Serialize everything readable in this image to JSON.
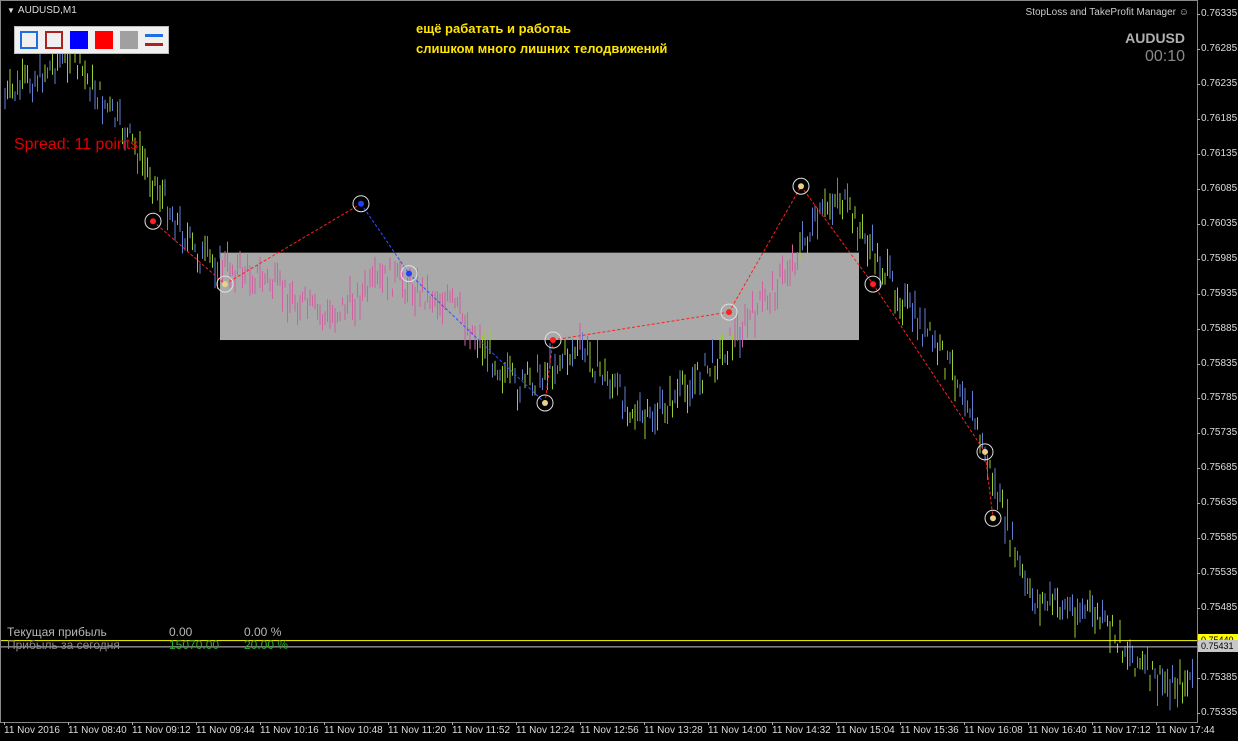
{
  "window": {
    "symbol_timeframe": "AUDUSD,M1",
    "indicator_name": "StopLoss and TakeProfit Manager ☺"
  },
  "color_panel": {
    "buttons": [
      {
        "name": "outline-blue",
        "fill": "#f0f0f0",
        "border": "#1f6fe0"
      },
      {
        "name": "outline-red",
        "fill": "#f0f0f0",
        "border": "#b02020"
      },
      {
        "name": "solid-blue",
        "fill": "#0000ff",
        "border": "#0000ff"
      },
      {
        "name": "solid-red",
        "fill": "#ff0000",
        "border": "#ff0000"
      },
      {
        "name": "solid-gray",
        "fill": "#a0a0a0",
        "border": "#a0a0a0"
      },
      {
        "name": "lines-blue-red",
        "fill": "",
        "border": ""
      }
    ]
  },
  "annotations": {
    "line1": "ещё  рабатать и работаь",
    "line2": "слишком много лишних телодвижений",
    "spread": "Spread: 11 points"
  },
  "symbol_box": {
    "symbol": "AUDUSD",
    "timer": "00:10"
  },
  "profit_panel": {
    "current_label": "Текущая прибыль",
    "current_value": "0.00",
    "current_percent": "0.00 %",
    "today_label": "Прибыль за сегодня",
    "today_value": "15070.00",
    "today_percent": "20.00 %"
  },
  "price_axis": {
    "ticks": [
      "0.76335",
      "0.76285",
      "0.76235",
      "0.76185",
      "0.76135",
      "0.76085",
      "0.76035",
      "0.75985",
      "0.75935",
      "0.75885",
      "0.75835",
      "0.75785",
      "0.75735",
      "0.75685",
      "0.75635",
      "0.75585",
      "0.75535",
      "0.75485",
      "0.75435",
      "0.75385",
      "0.75335"
    ],
    "bid_label": "0.75440",
    "bid_value": 0.7544,
    "ask_label": "0.75431",
    "ask_value": 0.75431
  },
  "time_axis": {
    "ticks": [
      "11 Nov 2016",
      "11 Nov 08:40",
      "11 Nov 09:12",
      "11 Nov 09:44",
      "11 Nov 10:16",
      "11 Nov 10:48",
      "11 Nov 11:20",
      "11 Nov 11:52",
      "11 Nov 12:24",
      "11 Nov 12:56",
      "11 Nov 13:28",
      "11 Nov 14:00",
      "11 Nov 14:32",
      "11 Nov 15:04",
      "11 Nov 15:36",
      "11 Nov 16:08",
      "11 Nov 16:40",
      "11 Nov 17:12",
      "11 Nov 17:44"
    ]
  },
  "colors": {
    "background": "#000000",
    "bull": "#9acd32",
    "bear": "#5f7fd0",
    "zone_bar": "#d060a0",
    "zone": "#a9a9a9",
    "title": "#ffe600",
    "spread": "#e00000",
    "bid_line": "#ffff00",
    "ask_line": "#c8c8c8",
    "today_profit": "#2fa82f"
  },
  "chart_data": {
    "type": "candlestick",
    "instrument": "AUDUSD",
    "timeframe": "M1",
    "ylim": [
      0.75335,
      0.76335
    ],
    "zone": {
      "price_high": 0.75995,
      "price_low": 0.7587,
      "start": "11 Nov 09:44",
      "end": "11 Nov 15:04"
    },
    "close_path": [
      {
        "time": "11 Nov 2016",
        "price": 0.76215
      },
      {
        "time": "11 Nov 08:40",
        "price": 0.7628
      },
      {
        "time": "11 Nov 09:12",
        "price": 0.7615
      },
      {
        "time": "11 Nov 09:44",
        "price": 0.7599
      },
      {
        "time": "11 Nov 10:16",
        "price": 0.7596
      },
      {
        "time": "11 Nov 10:48",
        "price": 0.759
      },
      {
        "time": "11 Nov 11:20",
        "price": 0.7596
      },
      {
        "time": "11 Nov 11:52",
        "price": 0.7592
      },
      {
        "time": "11 Nov 12:24",
        "price": 0.758
      },
      {
        "time": "11 Nov 12:56",
        "price": 0.7586
      },
      {
        "time": "11 Nov 13:28",
        "price": 0.7575
      },
      {
        "time": "11 Nov 14:00",
        "price": 0.7583
      },
      {
        "time": "11 Nov 14:32",
        "price": 0.7594
      },
      {
        "time": "11 Nov 15:04",
        "price": 0.7608
      },
      {
        "time": "11 Nov 15:36",
        "price": 0.7593
      },
      {
        "time": "11 Nov 16:08",
        "price": 0.758
      },
      {
        "time": "11 Nov 16:40",
        "price": 0.755
      },
      {
        "time": "11 Nov 17:12",
        "price": 0.7548
      },
      {
        "time": "11 Nov 17:44",
        "price": 0.7538
      }
    ],
    "trade_markers": [
      {
        "time": "11 Nov 09:12",
        "price": 0.7604,
        "side": "sell"
      },
      {
        "time": "11 Nov 09:44",
        "price": 0.7595,
        "side": "close"
      },
      {
        "time": "11 Nov 10:48",
        "price": 0.76065,
        "side": "buy"
      },
      {
        "time": "11 Nov 11:20",
        "price": 0.75965,
        "side": "buy"
      },
      {
        "time": "11 Nov 12:24",
        "price": 0.7578,
        "side": "close"
      },
      {
        "time": "11 Nov 12:24",
        "price": 0.7587,
        "side": "sell"
      },
      {
        "time": "11 Nov 14:00",
        "price": 0.7591,
        "side": "sell"
      },
      {
        "time": "11 Nov 14:32",
        "price": 0.7609,
        "side": "close"
      },
      {
        "time": "11 Nov 15:04",
        "price": 0.7595,
        "side": "sell"
      },
      {
        "time": "11 Nov 16:08",
        "price": 0.7571,
        "side": "close"
      },
      {
        "time": "11 Nov 16:08",
        "price": 0.75615,
        "side": "close"
      }
    ]
  }
}
